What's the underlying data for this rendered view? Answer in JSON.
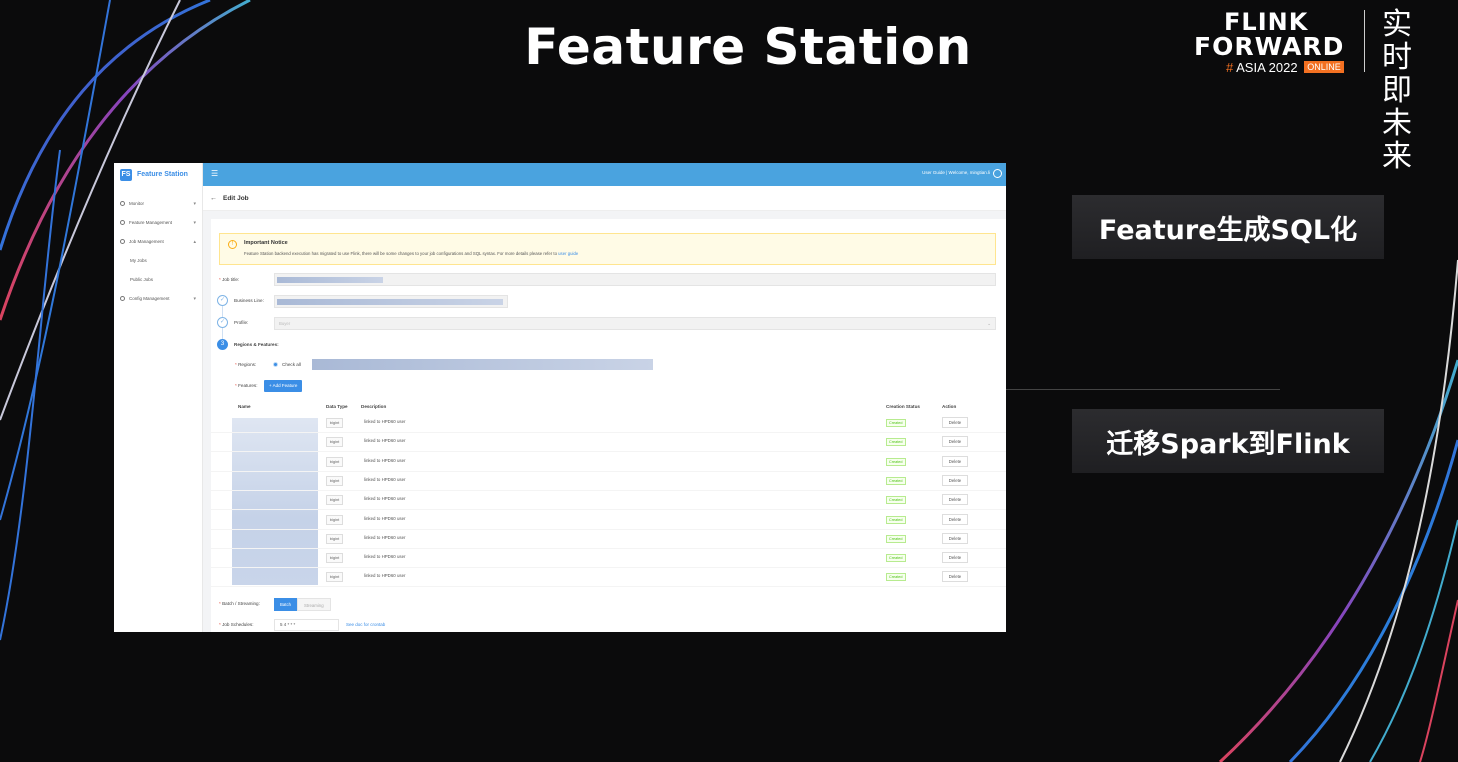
{
  "slide": {
    "title": "Feature Station",
    "logo": {
      "line1": "FLINK",
      "line2": "FORWARD",
      "hash": "#",
      "event": "ASIA 2022",
      "badge": "ONLINE",
      "cn": "实时即未来"
    },
    "cards": [
      "Feature生成SQL化",
      "迁移Spark到Flink"
    ]
  },
  "app": {
    "brand": "Feature Station",
    "brand_logo": "FS",
    "menu_icon": "☰",
    "top_right": "User Guide  |  Welcome, mingtian.li",
    "nav": [
      {
        "label": "Monitor",
        "chevron": "▾"
      },
      {
        "label": "Feature Management",
        "chevron": "▾"
      },
      {
        "label": "Job Management",
        "chevron": "▴"
      },
      {
        "label": "My Jobs"
      },
      {
        "label": "Public Jobs"
      },
      {
        "label": "Config Management",
        "chevron": "▾"
      }
    ],
    "page_title": "Edit Job",
    "back_icon": "←",
    "notice": {
      "icon": "!",
      "title": "Important Notice",
      "text": "Feature Station backend execution has migrated to use Flink, there will be some changes to your job configurations and SQL syntax. For more details please refer to ",
      "link": "user guide"
    },
    "form": {
      "job_title_label": "Job title:",
      "business_line_label": "Business Line:",
      "profile_label": "Profile:",
      "profile_placeholder": "Buyer",
      "step3_number": "3",
      "regions_features_label": "Regions & Features:",
      "regions_label": "Regions:",
      "check_all": "Check all",
      "features_label": "Features:",
      "add_feature": "+  Add Feature",
      "batch_label": "Batch / Streaming:",
      "batch": "Batch",
      "streaming": "Streaming",
      "schedule_label": "Job Schedules:",
      "schedule_value": "5 4 * * *",
      "cron_link": "See doc for crontab"
    },
    "table": {
      "headers": [
        "Name",
        "Data Type",
        "Description",
        "Creation Status",
        "Action"
      ],
      "rows": [
        {
          "type": "bigint",
          "desc": "linked to HPD60 user",
          "status": "Created",
          "action": "Delete"
        },
        {
          "type": "bigint",
          "desc": "linked to HPD60 user",
          "status": "Created",
          "action": "Delete"
        },
        {
          "type": "bigint",
          "desc": "linked to HPD60 user",
          "status": "Created",
          "action": "Delete"
        },
        {
          "type": "bigint",
          "desc": "linked to HPD60 user",
          "status": "Created",
          "action": "Delete"
        },
        {
          "type": "bigint",
          "desc": "linked to HPD60 user",
          "status": "Created",
          "action": "Delete"
        },
        {
          "type": "bigint",
          "desc": "linked to HPD60 user",
          "status": "Created",
          "action": "Delete"
        },
        {
          "type": "bigint",
          "desc": "linked to HPD60 user",
          "status": "Created",
          "action": "Delete"
        },
        {
          "type": "bigint",
          "desc": "linked to HPD60 user",
          "status": "Created",
          "action": "Delete"
        },
        {
          "type": "bigint",
          "desc": "linked to HPD60 user",
          "status": "Created",
          "action": "Delete"
        }
      ]
    }
  },
  "colors": {
    "accent": "#3b8ee6",
    "header": "#4aa3df",
    "brand_orange": "#f37021"
  }
}
